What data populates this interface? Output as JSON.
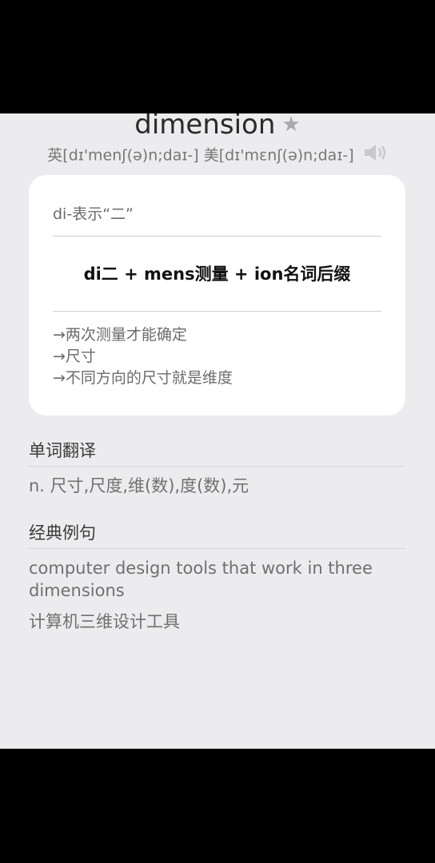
{
  "word": {
    "title": "dimension",
    "star_icon": "star-icon",
    "phonetic": "英[dɪ'menʃ(ə)n;daɪ-] 美[dɪ'mɛnʃ(ə)n;daɪ-]",
    "speaker_icon": "speaker-icon"
  },
  "mnemonic": {
    "root": "di-表示“二”",
    "formula": "di二 + mens测量 + ion名词后缀",
    "lines": [
      "→两次测量才能确定",
      "→尺寸",
      "→不同方向的尺寸就是维度"
    ]
  },
  "translation": {
    "heading": "单词翻译",
    "text": "n. 尺寸,尺度,维(数),度(数),元"
  },
  "examples": {
    "heading": "经典例句",
    "sentence_en": "computer design tools that work in three dimensions",
    "sentence_zh": "计算机三维设计工具"
  },
  "colors": {
    "background": "#ecebed",
    "card": "#ffffff",
    "outer": "#000000"
  }
}
